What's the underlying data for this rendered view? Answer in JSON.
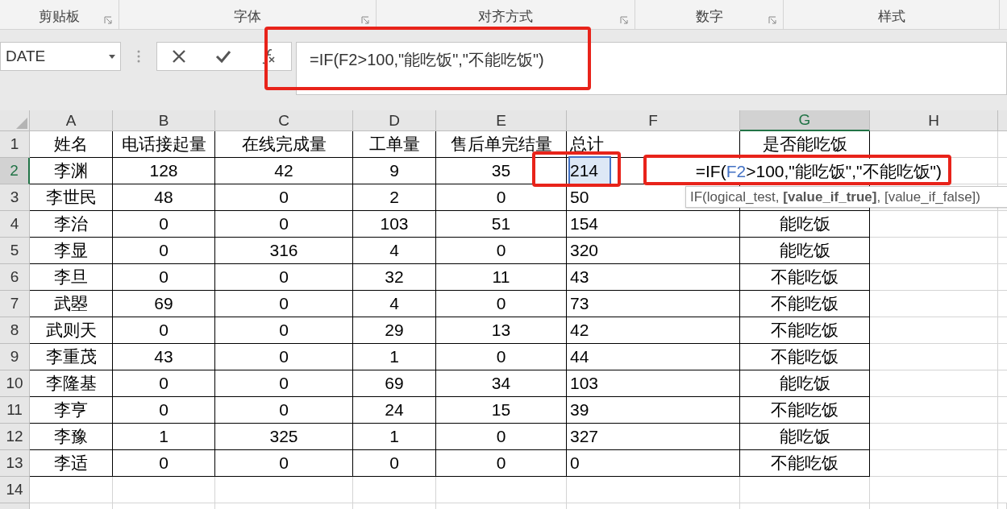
{
  "ribbon_groups": [
    {
      "label": "剪贴板",
      "launcher": true
    },
    {
      "label": "字体",
      "launcher": true
    },
    {
      "label": "对齐方式",
      "launcher": true
    },
    {
      "label": "数字",
      "launcher": true
    },
    {
      "label": "样式",
      "launcher": false
    }
  ],
  "formula_bar": {
    "name_box": "DATE",
    "formula": "=IF(F2>100,\"能吃饭\",\"不能吃饭\")"
  },
  "columns": [
    {
      "label": "A",
      "selected": false
    },
    {
      "label": "B",
      "selected": false
    },
    {
      "label": "C",
      "selected": false
    },
    {
      "label": "D",
      "selected": false
    },
    {
      "label": "E",
      "selected": false
    },
    {
      "label": "F",
      "selected": false
    },
    {
      "label": "G",
      "selected": true
    },
    {
      "label": "H",
      "selected": false
    }
  ],
  "rows": [
    {
      "number": "1",
      "selected": false,
      "cells": [
        "姓名",
        "电话接起量",
        "在线完成量",
        "工单量",
        "售后单完结量",
        "总计",
        "是否能吃饭"
      ]
    },
    {
      "number": "2",
      "selected": true,
      "cells": [
        "李渊",
        "128",
        "42",
        "9",
        "35",
        {
          "text": "214",
          "referenced": true
        }
      ]
    },
    {
      "number": "3",
      "selected": false,
      "cells": [
        "李世民",
        "48",
        "0",
        "2",
        "0",
        "50"
      ]
    },
    {
      "number": "4",
      "selected": false,
      "cells": [
        "李治",
        "0",
        "0",
        "103",
        "51",
        "154",
        "能吃饭"
      ]
    },
    {
      "number": "5",
      "selected": false,
      "cells": [
        "李显",
        "0",
        "316",
        "4",
        "0",
        "320",
        "能吃饭"
      ]
    },
    {
      "number": "6",
      "selected": false,
      "cells": [
        "李旦",
        "0",
        "0",
        "32",
        "11",
        "43",
        "不能吃饭"
      ]
    },
    {
      "number": "7",
      "selected": false,
      "cells": [
        "武曌",
        "69",
        "0",
        "4",
        "0",
        "73",
        "不能吃饭"
      ]
    },
    {
      "number": "8",
      "selected": false,
      "cells": [
        "武则天",
        "0",
        "0",
        "29",
        "13",
        "42",
        "不能吃饭"
      ]
    },
    {
      "number": "9",
      "selected": false,
      "cells": [
        "李重茂",
        "43",
        "0",
        "1",
        "0",
        "44",
        "不能吃饭"
      ]
    },
    {
      "number": "10",
      "selected": false,
      "cells": [
        "李隆基",
        "0",
        "0",
        "69",
        "34",
        "103",
        "能吃饭"
      ]
    },
    {
      "number": "11",
      "selected": false,
      "cells": [
        "李亨",
        "0",
        "0",
        "24",
        "15",
        "39",
        "不能吃饭"
      ]
    },
    {
      "number": "12",
      "selected": false,
      "cells": [
        "李豫",
        "1",
        "325",
        "1",
        "0",
        "327",
        "能吃饭"
      ]
    },
    {
      "number": "13",
      "selected": false,
      "cells": [
        "李适",
        "0",
        "0",
        "0",
        "0",
        "0",
        "不能吃饭"
      ]
    },
    {
      "number": "14",
      "selected": false
    }
  ],
  "cell_editor": {
    "parts": [
      {
        "kind": "plain",
        "text": "=IF("
      },
      {
        "kind": "reference",
        "text": "F2"
      },
      {
        "kind": "plain",
        "text": ">100,\"能吃饭\",\"不能吃饭\")"
      }
    ]
  },
  "tooltip": "IF(logical_test, **[value_if_true]**, [value_if_false])"
}
